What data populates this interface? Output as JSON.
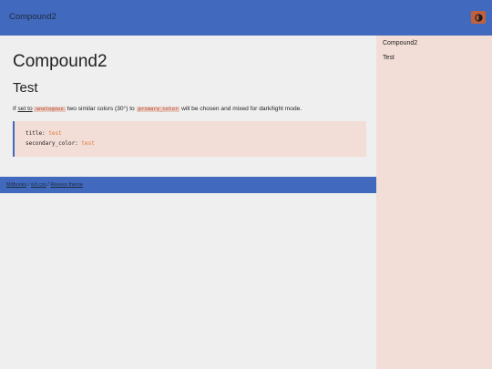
{
  "header": {
    "site_title": "Compound2"
  },
  "theme_toggle": {
    "icon": "half-circle-contrast-icon",
    "color": "#c0603f"
  },
  "main": {
    "page_title": "Compound2",
    "post_title": "Test",
    "paragraph": {
      "part1": "If ",
      "link": "set to",
      "part2": " ",
      "code1": "analogous",
      "part3": " two similar colors (30°) to ",
      "code2": "primary_color",
      "part4": " will be chosen and mixed for dark/light mode."
    },
    "code_block": {
      "lines": [
        {
          "key": "title:",
          "value": "test"
        },
        {
          "key": "secondary_color:",
          "value": "test"
        }
      ]
    }
  },
  "footer": {
    "links": [
      "Mdbooks",
      "w3.css",
      "Reeves theme"
    ],
    "separator": " / "
  },
  "sidebar": {
    "items": [
      {
        "label": "Compound2"
      },
      {
        "label": "Test"
      }
    ]
  },
  "colors": {
    "accent": "#4169be",
    "sidebar_bg": "#f3ddd7",
    "page_bg": "#efefef",
    "code_value": "#e07a3c"
  }
}
